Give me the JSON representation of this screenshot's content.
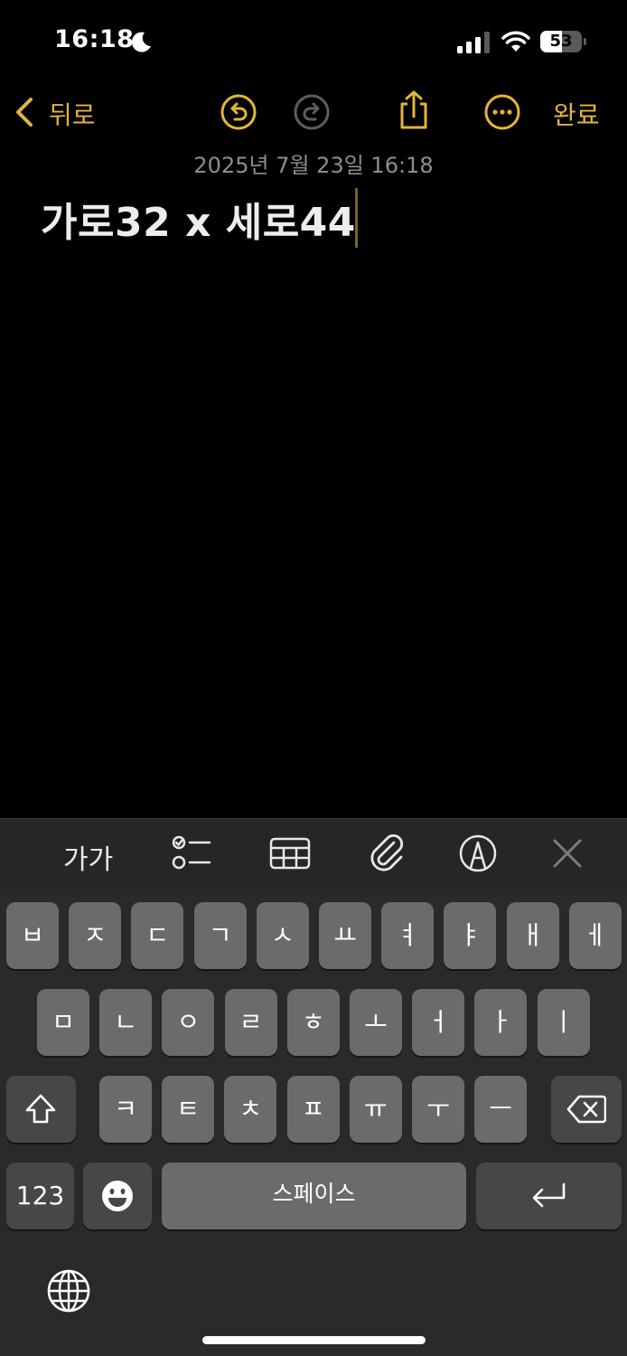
{
  "status_bar": {
    "time": "16:18",
    "battery": "53",
    "battery_level": 0.53,
    "icons": [
      "moon-icon",
      "signal-icon",
      "wifi-icon",
      "battery-icon"
    ]
  },
  "toolbar": {
    "back_label": "뒤로",
    "done_label": "완료",
    "icons": [
      "chevron-left-icon",
      "undo-icon",
      "redo-icon",
      "share-icon",
      "more-icon"
    ]
  },
  "note": {
    "date": "2025년 7월 23일 16:18",
    "body": "가로32 x 세로44"
  },
  "format_bar": {
    "text_style_label": "가가",
    "icons": [
      "checklist-icon",
      "table-icon",
      "paperclip-icon",
      "markup-icon",
      "close-icon"
    ]
  },
  "keyboard": {
    "row1": [
      "ㅂ",
      "ㅈ",
      "ㄷ",
      "ㄱ",
      "ㅅ",
      "ㅛ",
      "ㅕ",
      "ㅑ",
      "ㅐ",
      "ㅔ"
    ],
    "row2": [
      "ㅁ",
      "ㄴ",
      "ㅇ",
      "ㄹ",
      "ㅎ",
      "ㅗ",
      "ㅓ",
      "ㅏ",
      "ㅣ"
    ],
    "row3": [
      "ㅋ",
      "ㅌ",
      "ㅊ",
      "ㅍ",
      "ㅠ",
      "ㅜ",
      "ㅡ"
    ],
    "numbers_label": "123",
    "space_label": "스페이스",
    "icons": [
      "shift-icon",
      "backspace-icon",
      "emoji-icon",
      "return-icon",
      "globe-icon"
    ]
  },
  "colors": {
    "accent": "#e4b43a",
    "background": "#000000",
    "key": "#6b6b6b",
    "key_dark": "#474747"
  }
}
